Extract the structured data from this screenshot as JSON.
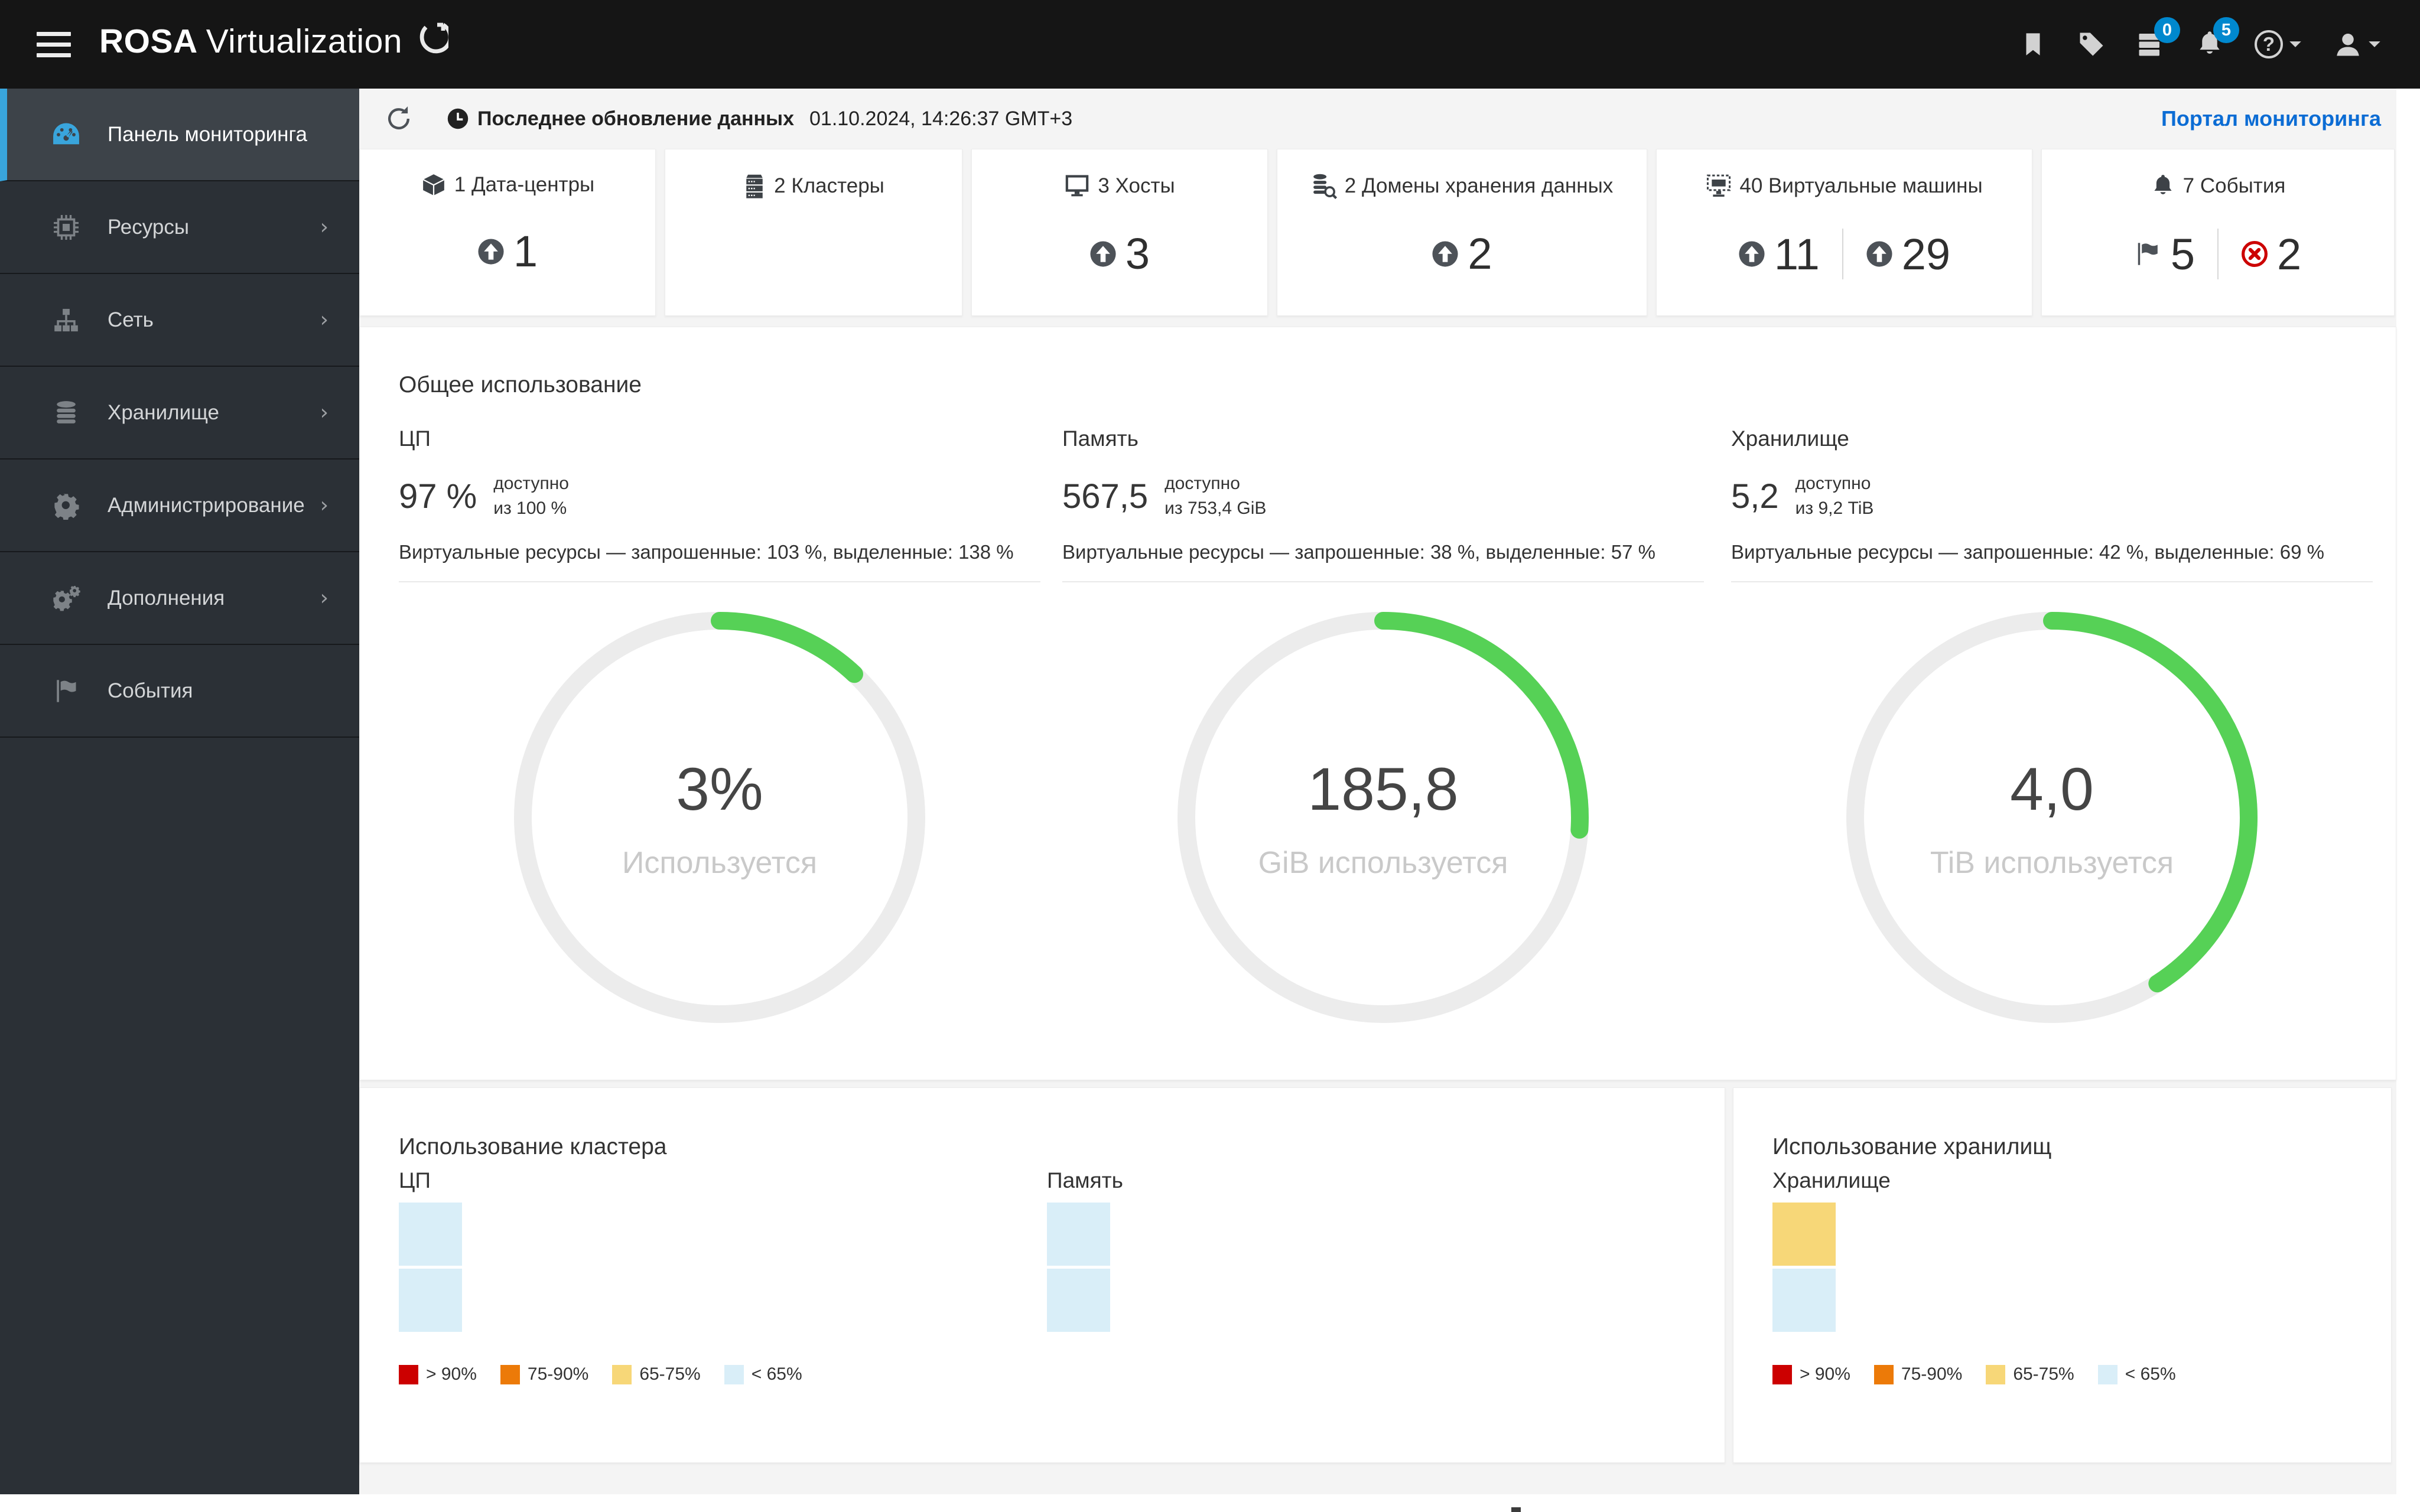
{
  "colors": {
    "header_bg": "#151515",
    "sidebar_bg": "#2b3036",
    "sidebar_active_bg": "#3d4349",
    "accent": "#39a5dc",
    "badge": "#0088ce",
    "link": "#0b6cd4",
    "gauge_green": "#56d156",
    "gauge_track": "#ececec"
  },
  "header": {
    "brand_bold": "ROSA",
    "brand_rest": "Virtualization",
    "badges": {
      "tasks": "0",
      "notifications": "5"
    }
  },
  "toolbar": {
    "last_update_label": "Последнее обновление данных",
    "last_update_value": "01.10.2024, 14:26:37 GMT+3",
    "portal_link": "Портал мониторинга"
  },
  "sidebar": {
    "items": [
      {
        "label": "Панель мониторинга",
        "active": true
      },
      {
        "label": "Ресурсы"
      },
      {
        "label": "Сеть"
      },
      {
        "label": "Хранилище"
      },
      {
        "label": "Администрирование"
      },
      {
        "label": "Дополнения"
      },
      {
        "label": "События"
      }
    ]
  },
  "stat_cards": [
    {
      "title": "1 Дата-центры",
      "counts": [
        {
          "icon": "arrow-up-circle",
          "value": "1"
        }
      ]
    },
    {
      "title": "2 Кластеры",
      "counts": []
    },
    {
      "title": "3 Хосты",
      "counts": [
        {
          "icon": "arrow-up-circle",
          "value": "3"
        }
      ]
    },
    {
      "title": "2 Домены хранения данных",
      "counts": [
        {
          "icon": "arrow-up-circle",
          "value": "2"
        }
      ]
    },
    {
      "title": "40 Виртуальные машины",
      "counts": [
        {
          "icon": "arrow-up-circle",
          "value": "11"
        },
        {
          "icon": "arrow-up-circle",
          "value": "29"
        }
      ]
    },
    {
      "title": "7 События",
      "counts": [
        {
          "icon": "flag",
          "value": "5"
        },
        {
          "icon": "error-circle",
          "value": "2"
        }
      ]
    }
  ],
  "overall": {
    "title": "Общее использование",
    "columns": [
      {
        "label": "ЦП",
        "value": "97 %",
        "available_label": "доступно",
        "available_of": "из 100 %",
        "virtual": "Виртуальные ресурсы — запрошенные: 103 %, выделенные: 138 %",
        "donut": {
          "center": "3%",
          "caption": "Используется",
          "arc_percent": 12
        }
      },
      {
        "label": "Память",
        "value": "567,5",
        "available_label": "доступно",
        "available_of": "из 753,4 GiB",
        "virtual": "Виртуальные ресурсы — запрошенные: 38 %, выделенные: 57 %",
        "donut": {
          "center": "185,8",
          "caption": "GiB используется",
          "arc_percent": 26
        }
      },
      {
        "label": "Хранилище",
        "value": "5,2",
        "available_label": "доступно",
        "available_of": "из 9,2 TiB",
        "virtual": "Виртуальные ресурсы — запрошенные: 42 %, выделенные: 69 %",
        "donut": {
          "center": "4,0",
          "caption": "TiB используется",
          "arc_percent": 41
        }
      }
    ]
  },
  "cluster_card": {
    "title": "Использование кластера",
    "groups": [
      {
        "label": "ЦП",
        "cells": [
          "#d9eef8",
          "#d9eef8"
        ]
      },
      {
        "label": "Память",
        "cells": [
          "#d9eef8",
          "#d9eef8"
        ]
      }
    ]
  },
  "storage_card": {
    "title": "Использование хранилищ",
    "groups": [
      {
        "label": "Хранилище",
        "cells": [
          "#f7d778",
          "#d9eef8"
        ]
      }
    ]
  },
  "legend": [
    {
      "label": "> 90%",
      "color": "#cc0000"
    },
    {
      "label": "75-90%",
      "color": "#ec7a08"
    },
    {
      "label": "65-75%",
      "color": "#f7d778"
    },
    {
      "label": "< 65%",
      "color": "#d9eef8"
    }
  ]
}
